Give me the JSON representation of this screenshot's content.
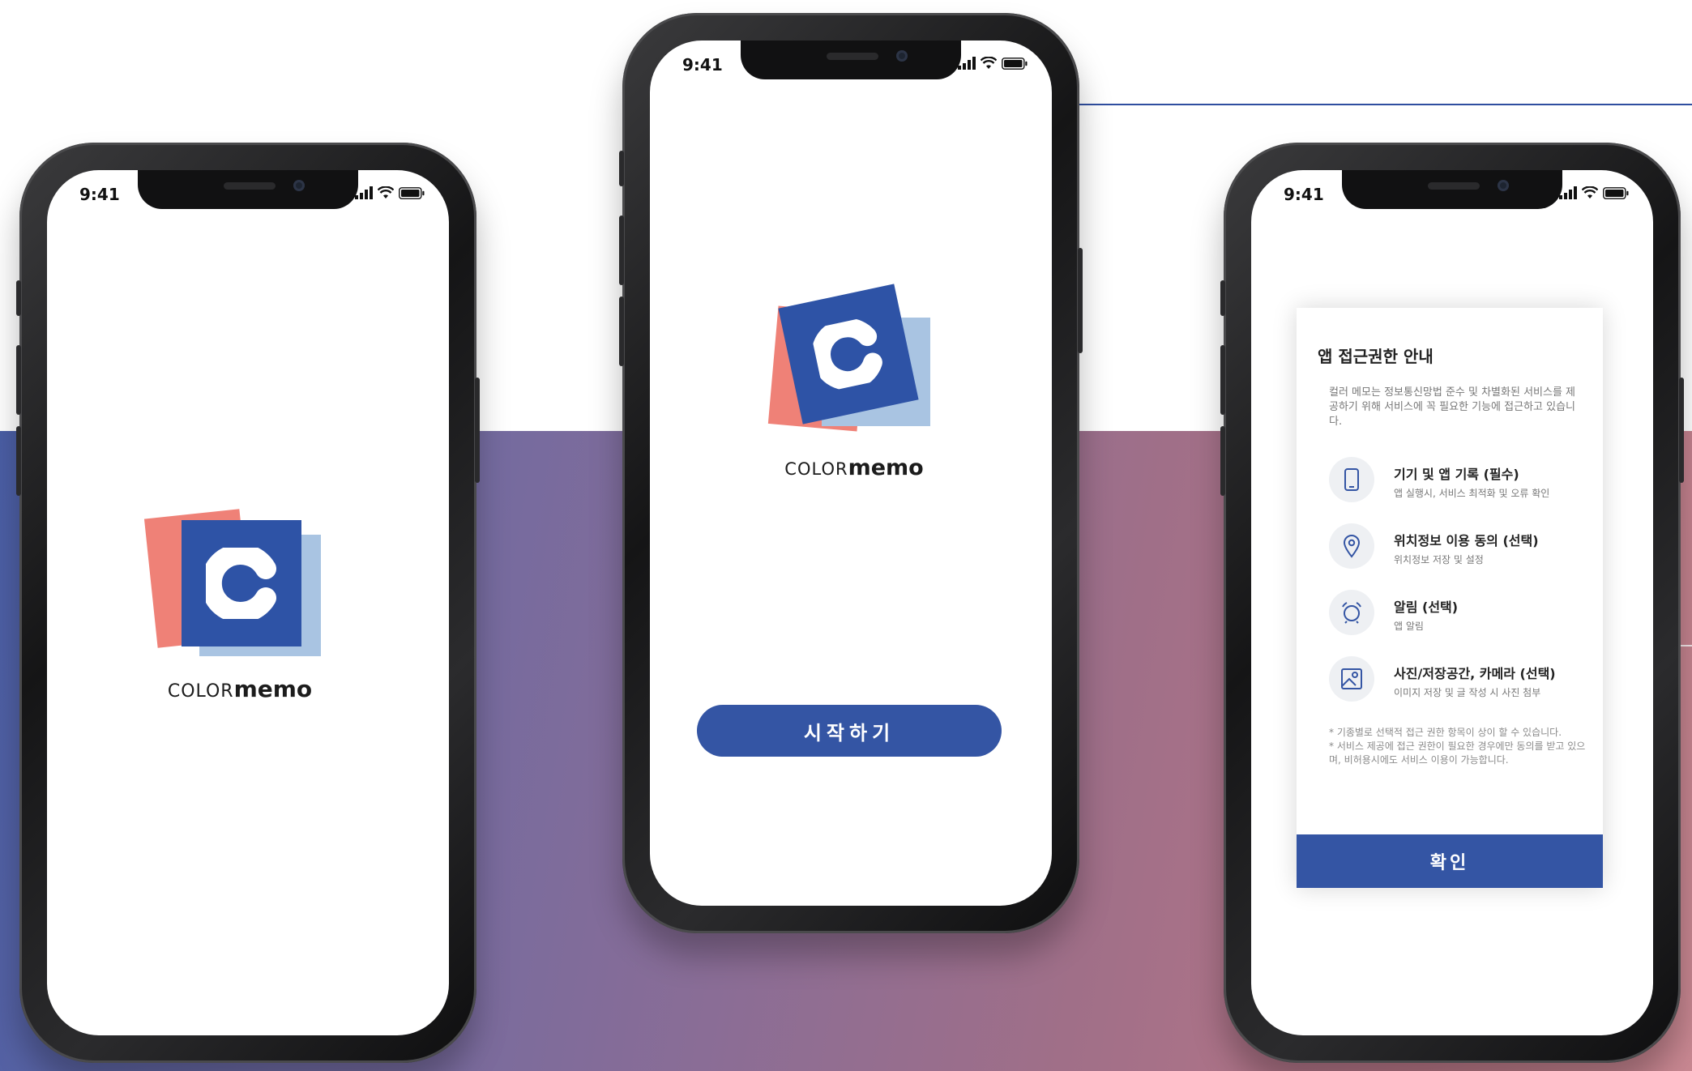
{
  "colors": {
    "brand_blue": "#2e53a6",
    "coral": "#ef8177",
    "light_blue": "#a9c4e2",
    "button_blue": "#3455a4"
  },
  "status_bar": {
    "time": "9:41"
  },
  "brand": {
    "logo_letter": "c",
    "word_color": "COLOR",
    "word_memo": "memo"
  },
  "start_screen": {
    "start_button": "시작하기"
  },
  "permission_dialog": {
    "title": "앱 접근권한 안내",
    "description": "컬러 메모는 정보통신망법 준수 및 차별화된 서비스를 제공하기 위해 서비스에 꼭 필요한 기능에 접근하고 있습니다.",
    "items": [
      {
        "icon": "phone-icon",
        "title": "기기 및 앱 기록 (필수)",
        "subtitle": "앱 실행시, 서비스 최적화 및 오류 확인"
      },
      {
        "icon": "location-pin-icon",
        "title": "위치정보 이용 동의 (선택)",
        "subtitle": "위치정보 저장 및 설정"
      },
      {
        "icon": "bell-icon",
        "title": "알림 (선택)",
        "subtitle": "앱 알림"
      },
      {
        "icon": "image-icon",
        "title": "사진/저장공간, 카메라 (선택)",
        "subtitle": "이미지 저장 및 글 작성 시 사진 첨부"
      }
    ],
    "notes": [
      "* 기종별로 선택적 접근 권한 항목이 상이 할 수 있습니다.",
      "* 서비스 제공에 접근 권한이 필요한 경우에만 동의를 받고 있으며, 비허용시에도 서비스 이용이 가능합니다."
    ],
    "confirm_button": "확인"
  }
}
